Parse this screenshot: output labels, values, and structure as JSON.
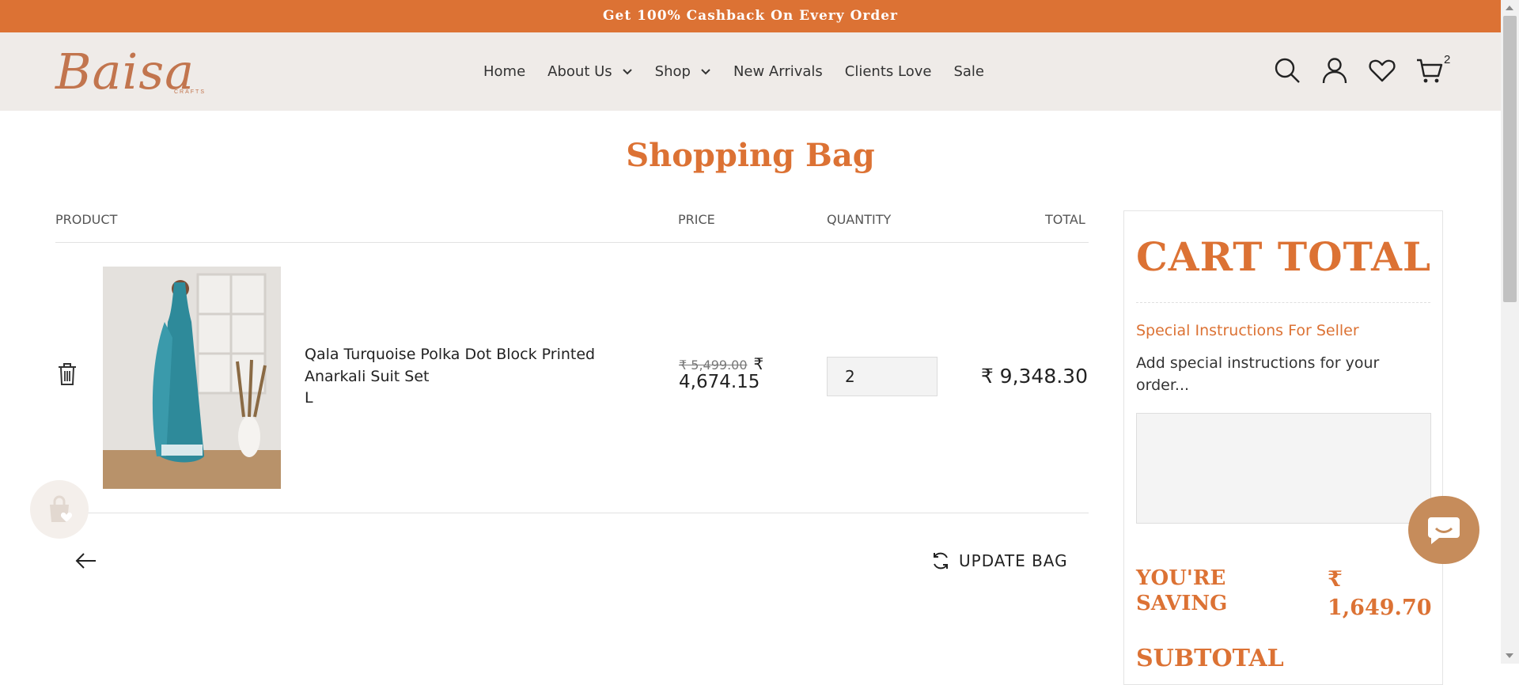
{
  "announcement": "Get 100% Cashback On Every Order",
  "brand": {
    "logo_text": "Baisa",
    "logo_sub": "CRAFTS",
    "accent_color": "#dc7234"
  },
  "nav": {
    "items": [
      {
        "label": "Home"
      },
      {
        "label": "About Us"
      },
      {
        "label": "Shop"
      },
      {
        "label": "New Arrivals"
      },
      {
        "label": "Clients Love"
      },
      {
        "label": "Sale"
      }
    ]
  },
  "header_icons": [
    "search-icon",
    "account-icon",
    "wishlist-heart-icon",
    "cart-icon"
  ],
  "cart_count": "2",
  "page_title": "Shopping Bag",
  "table": {
    "headers": {
      "product": "PRODUCT",
      "price": "PRICE",
      "quantity": "QUANTITY",
      "total": "TOTAL"
    }
  },
  "cart_item": {
    "name": "Qala Turquoise Polka Dot Block Printed Anarkali Suit Set",
    "variant": "L",
    "price_original": "₹ 5,499.00",
    "price_symbol": "₹",
    "price_sale": "4,674.15",
    "quantity": "2",
    "line_total": "₹ 9,348.30"
  },
  "actions": {
    "update_bag": "UPDATE BAG"
  },
  "cart_total": {
    "title": "CART TOTAL",
    "special_instructions_label": "Special Instructions For Seller",
    "special_instructions_desc": "Add special instructions for your order...",
    "saving_label": "YOU'RE SAVING",
    "saving_value": "₹ 1,649.70",
    "subtotal_label": "SUBTOTAL"
  }
}
